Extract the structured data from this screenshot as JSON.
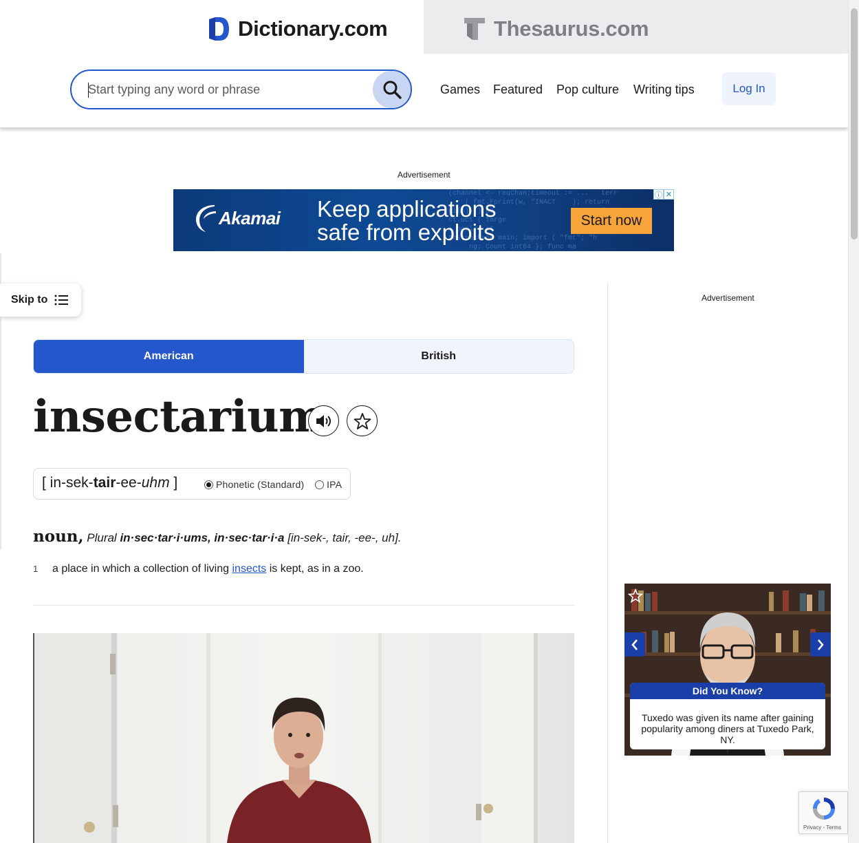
{
  "site_tabs": {
    "dictionary": "Dictionary.com",
    "thesaurus": "Thesaurus.com"
  },
  "search": {
    "placeholder": "Start typing any word or phrase",
    "value": ""
  },
  "nav": {
    "items": [
      "Games",
      "Featured",
      "Pop culture",
      "Writing tips"
    ],
    "login": "Log In"
  },
  "ads": {
    "label": "Advertisement",
    "banner": {
      "brand": "Akamai",
      "headline_line1": "Keep applications",
      "headline_line2": "safe from exploits",
      "cta": "Start now"
    },
    "sidebar_label": "Advertisement"
  },
  "skip_to": "Skip to",
  "dialect": {
    "options": [
      "American",
      "British"
    ],
    "selected": "American"
  },
  "entry": {
    "headword": "insectarium",
    "pronunciation": {
      "open": "[ in-sek-",
      "stress": "tair",
      "mid": "-ee-",
      "italic": "uhm",
      "close": " ]"
    },
    "pron_options": [
      "Phonetic (Standard)",
      "IPA"
    ],
    "pron_selected": "Phonetic (Standard)",
    "pos": "noun,",
    "plural_label": "Plural",
    "plural_forms": "in·sec·tar·i·ums, in·sec·tar·i·a",
    "plural_pron": "[in-sek-, tair, -ee-, uh].",
    "senses": [
      {
        "number": "1",
        "before": "a place in which a collection of living ",
        "link": "insects",
        "after": " is kept, as in a zoo."
      }
    ]
  },
  "did_you_know": {
    "title": "Did You Know?",
    "text": "Tuxedo was given its name after gaining popularity among diners at Tuxedo Park, NY."
  },
  "recaptcha": {
    "links": "Privacy - Terms"
  },
  "colors": {
    "brand_blue": "#2456cc",
    "card_blue": "#1a3fa8",
    "cta_orange": "#f7a43a"
  }
}
